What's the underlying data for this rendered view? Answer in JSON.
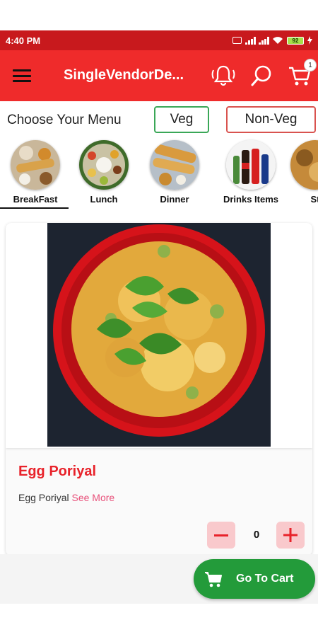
{
  "status_bar": {
    "time": "4:40 PM",
    "battery": "92"
  },
  "app_bar": {
    "title": "SingleVendorDe...",
    "cart_count": "1"
  },
  "menu": {
    "label": "Choose Your Menu",
    "veg_label": "Veg",
    "nonveg_label": "Non-Veg"
  },
  "categories": [
    {
      "label": "BreakFast",
      "active": true
    },
    {
      "label": "Lunch",
      "active": false
    },
    {
      "label": "Dinner",
      "active": false
    },
    {
      "label": "Drinks Items",
      "active": false
    },
    {
      "label": "St",
      "active": false
    }
  ],
  "product": {
    "title": "Egg Poriyal",
    "description": "Egg Poriyal",
    "see_more": "See More",
    "quantity": "0"
  },
  "bottom": {
    "go_to_cart": "Go To Cart"
  },
  "colors": {
    "primary": "#ef2b2b",
    "status_bar": "#c8191d",
    "veg_border": "#3aa757",
    "nonveg_border": "#d9534f",
    "accent_green": "#239b3a",
    "title_red": "#e8222a"
  }
}
